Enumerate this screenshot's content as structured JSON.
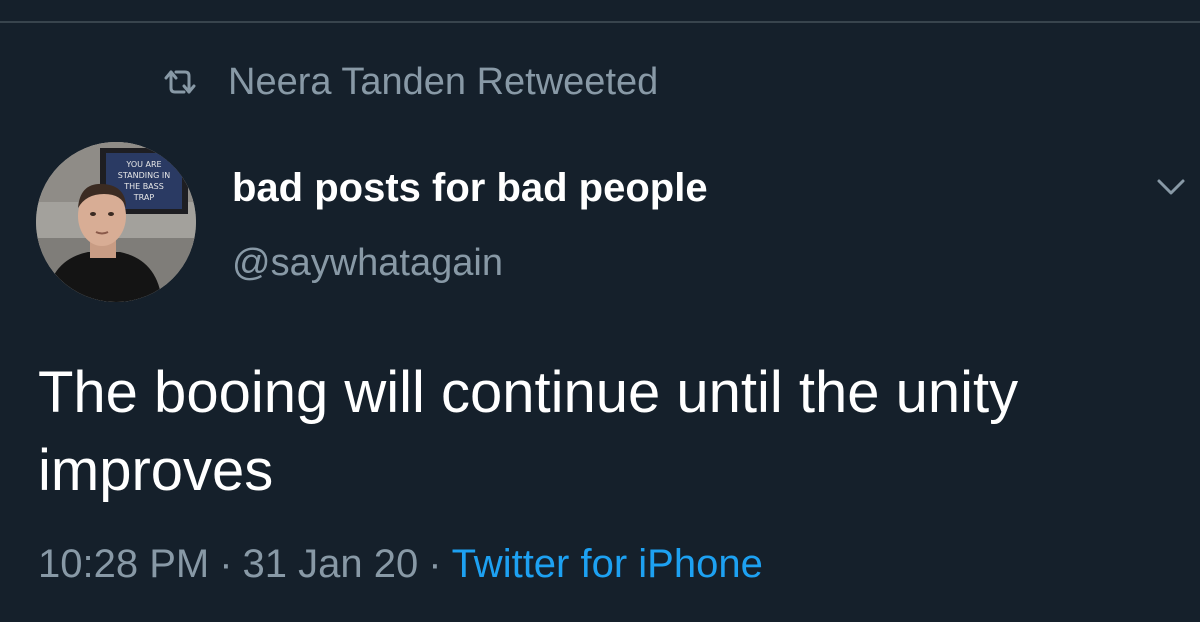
{
  "colors": {
    "background": "#15202b",
    "divider": "#38444d",
    "secondary_text": "#8899a6",
    "primary_text": "#ffffff",
    "link": "#1da1f2"
  },
  "retweet": {
    "icon": "retweet-icon",
    "text": "Neera Tanden Retweeted"
  },
  "author": {
    "display_name": "bad posts for bad people",
    "handle": "@saywhatagain",
    "avatar_sign_text": [
      "YOU ARE",
      "STANDING IN",
      "THE BASS",
      "TRAP"
    ]
  },
  "menu": {
    "icon": "chevron-down-icon"
  },
  "tweet": {
    "text": "The booing will continue until the unity improves"
  },
  "meta": {
    "time": "10:28 PM",
    "separator": "·",
    "date": "31 Jan 20",
    "source": "Twitter for iPhone"
  }
}
